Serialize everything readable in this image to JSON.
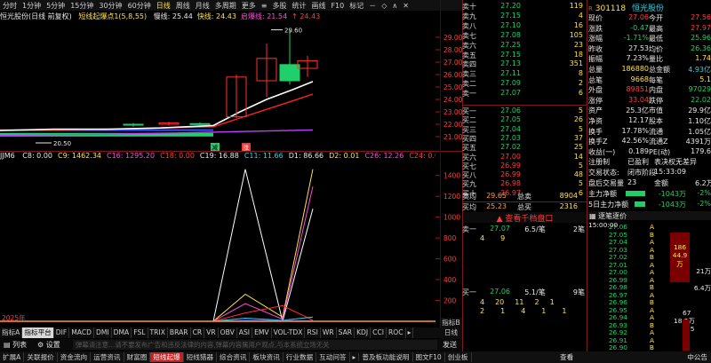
{
  "toolbar": {
    "items": [
      "分时",
      "1分钟",
      "5分钟",
      "15分钟",
      "30分钟",
      "60分钟",
      "日线",
      "周线",
      "月线",
      "多周期",
      "更多",
      "≡",
      "多股",
      "统计",
      "画线",
      "F10",
      "标记",
      "－",
      "◇",
      "∧",
      "✕"
    ],
    "selected": "日线"
  },
  "title_bar": {
    "stock": "恒光股份(日线 前复权)",
    "indicator": "短线起爆点1(5,8,55)",
    "seg": [
      {
        "t": "慢线: 25.44",
        "c": "w"
      },
      {
        "t": "快线: 24.43",
        "c": "y"
      },
      {
        "t": "启爆线: 21.54",
        "c": "m"
      },
      {
        "t": "↑ 24.43",
        "c": "r"
      }
    ]
  },
  "main_chart": {
    "y_ticks": [
      "29.00",
      "28.00",
      "27.00",
      "26.00",
      "25.00",
      "24.00",
      "23.00",
      "22.00",
      "21.00"
    ],
    "annotations": {
      "high": "29.60",
      "low": "20.50",
      "low_label": "20.50"
    },
    "markers": [
      "减",
      "涨"
    ],
    "candles": [
      {
        "o": 22.0,
        "h": 22.1,
        "l": 21.8,
        "c": 21.95
      },
      {
        "o": 22.0,
        "h": 22.2,
        "l": 21.9,
        "c": 22.1
      },
      {
        "o": 22.05,
        "h": 22.15,
        "l": 21.95,
        "c": 22.0
      },
      {
        "o": 22.6,
        "h": 26.0,
        "l": 22.5,
        "c": 25.8
      },
      {
        "o": 25.5,
        "h": 28.5,
        "l": 24.2,
        "c": 27.3
      },
      {
        "o": 26.8,
        "h": 29.6,
        "l": 25.2,
        "c": 25.5
      },
      {
        "o": 26.5,
        "h": 27.5,
        "l": 25.8,
        "c": 27.1
      }
    ]
  },
  "indicator_bar": {
    "name": "JJM6",
    "seg": [
      {
        "t": "C8: 0.00",
        "c": "w"
      },
      {
        "t": "C9: 1462.34",
        "c": "y"
      },
      {
        "t": "C16: 1295.20",
        "c": "m"
      },
      {
        "t": "C18: 0.00",
        "c": "r"
      },
      {
        "t": "C19: 16.88",
        "c": "w"
      },
      {
        "t": "C11: 11.66",
        "c": "c"
      },
      {
        "t": "D1: 86.66",
        "c": "w"
      },
      {
        "t": "D2: 0.01",
        "c": "y"
      },
      {
        "t": "C26: 12.26",
        "c": "m"
      },
      {
        "t": "C24: 0.00",
        "c": "r"
      }
    ]
  },
  "sub_chart": {
    "y_ticks": [
      "1400",
      "1200",
      "1000",
      "800",
      "600",
      "400",
      "200"
    ],
    "year_label": "2025年"
  },
  "tabs": [
    "指标A",
    "指标平台",
    "DIF",
    "MACD",
    "DMI",
    "DMA",
    "FSL",
    "TRIX",
    "BRAR",
    "CR",
    "VR",
    "OBV",
    "ASI",
    "EMV",
    "VOL-TDX",
    "RSI",
    "WR",
    "SAR",
    "KDJ",
    "CCI",
    "ROC",
    "▸"
  ],
  "tabs_right": [
    "指标B",
    "日线"
  ],
  "msg": {
    "list": "列表",
    "settings": "设置",
    "placeholder": "弹幕请注意…请不要发布广告和违反法律的内容,弹幕内容属用户观点,与本系统立场无关",
    "send": "发送"
  },
  "bottom_bar": [
    "扩展A",
    "关联报价",
    "资金流向",
    "运营资讯",
    "财富圈",
    "短线起爆",
    "短线猎器",
    "综合资讯",
    "板块资讯",
    "行业数据",
    "互动问答",
    "▸",
    "普及板功能说明",
    "图文F10",
    "创业板"
  ],
  "bottom_right": [
    "查看",
    "中公告"
  ],
  "order_book": {
    "asks": [
      {
        "lbl": "卖十",
        "p": "27.20",
        "v": "119"
      },
      {
        "lbl": "卖九",
        "p": "27.15",
        "v": "4"
      },
      {
        "lbl": "卖八",
        "p": "27.10",
        "v": "16"
      },
      {
        "lbl": "卖七",
        "p": "27.08",
        "v": "105"
      },
      {
        "lbl": "卖六",
        "p": "27.25",
        "v": "23"
      },
      {
        "lbl": "卖五",
        "p": "27.15",
        "v": "18"
      },
      {
        "lbl": "卖四",
        "p": "27.13",
        "v": "351"
      },
      {
        "lbl": "卖三",
        "p": "27.11",
        "v": "8"
      },
      {
        "lbl": "卖二",
        "p": "27.09",
        "v": "2"
      },
      {
        "lbl": "卖一",
        "p": "27.07",
        "v": "6"
      }
    ],
    "bids": [
      {
        "lbl": "买一",
        "p": "27.06",
        "v": "5"
      },
      {
        "lbl": "买二",
        "p": "27.05",
        "v": "26"
      },
      {
        "lbl": "买三",
        "p": "27.04",
        "v": "5"
      },
      {
        "lbl": "买四",
        "p": "27.03",
        "v": "37"
      },
      {
        "lbl": "买五",
        "p": "27.02",
        "v": "25"
      },
      {
        "lbl": "买六",
        "p": "27.00",
        "v": "14"
      },
      {
        "lbl": "买七",
        "p": "26.99",
        "v": "5"
      },
      {
        "lbl": "买八",
        "p": "26.99",
        "v": "48"
      },
      {
        "lbl": "买九",
        "p": "26.98",
        "v": "5"
      },
      {
        "lbl": "买十",
        "p": "26.97",
        "v": "6"
      }
    ],
    "avg_ask": {
      "lbl": "卖均",
      "p": "29.65",
      "t": "总卖",
      "v": "8904"
    },
    "avg_bid": {
      "lbl": "买均",
      "p": "25.23",
      "t": "总买",
      "v": "2316"
    }
  },
  "q1000": {
    "title": "查看千档盘口",
    "sell": {
      "lbl": "卖一",
      "p": "27.07",
      "q": "6.5/笔",
      "n": "2笔"
    },
    "sell_vals": [
      "4",
      "9"
    ],
    "buy": {
      "lbl": "买一",
      "p": "27.06",
      "q": "5.1/笔",
      "n": "9笔"
    },
    "buy_r1": [
      "4",
      "20",
      "11",
      "2",
      "1"
    ],
    "buy_r2": [
      "2",
      "1",
      "4",
      "1",
      "1"
    ]
  },
  "quote": {
    "code": "301118",
    "name": "恒光股份",
    "rows": [
      [
        {
          "t": "现价",
          "c": "w"
        },
        {
          "t": "27.06",
          "c": "r"
        },
        {
          "t": "今开",
          "c": "w"
        },
        {
          "t": "27.56",
          "c": "r"
        }
      ],
      [
        {
          "t": "涨跌",
          "c": "w"
        },
        {
          "t": "-0.47",
          "c": "g"
        },
        {
          "t": "最高",
          "c": "w"
        },
        {
          "t": "27.97",
          "c": "r"
        }
      ],
      [
        {
          "t": "涨幅",
          "c": "w"
        },
        {
          "t": "-1.71%",
          "c": "g"
        },
        {
          "t": "最低",
          "c": "w"
        },
        {
          "t": "25.96",
          "c": "g"
        }
      ],
      [
        {
          "t": "昨收",
          "c": "w"
        },
        {
          "t": "27.53",
          "c": "w"
        },
        {
          "t": "均价",
          "c": "w"
        },
        {
          "t": "26.36",
          "c": "g"
        }
      ],
      [
        {
          "t": "振幅",
          "c": "w"
        },
        {
          "t": "7.23%",
          "c": "w"
        },
        {
          "t": "量比",
          "c": "w"
        },
        {
          "t": "1.74",
          "c": "y"
        }
      ],
      [
        {
          "t": "总量",
          "c": "w"
        },
        {
          "t": "186880",
          "c": "y"
        },
        {
          "t": "总金额",
          "c": "w"
        },
        {
          "t": "4.93亿",
          "c": "c"
        }
      ],
      [
        {
          "t": "总笔",
          "c": "w"
        },
        {
          "t": "9668",
          "c": "y"
        },
        {
          "t": "每笔",
          "c": "w"
        },
        {
          "t": "5.1",
          "c": "y"
        }
      ],
      [
        {
          "t": "外盘",
          "c": "w"
        },
        {
          "t": "89851",
          "c": "r"
        },
        {
          "t": "内盘",
          "c": "w"
        },
        {
          "t": "97029",
          "c": "g"
        }
      ],
      [
        {
          "t": "涨停",
          "c": "w"
        },
        {
          "t": "33.04",
          "c": "r"
        },
        {
          "t": "跌停",
          "c": "w"
        },
        {
          "t": "22.02",
          "c": "g"
        }
      ],
      [
        {
          "t": "资产",
          "c": "w"
        },
        {
          "t": "25.3亿",
          "c": "w"
        },
        {
          "t": "市值",
          "c": "w"
        },
        {
          "t": "29.9亿",
          "c": "w"
        }
      ],
      [
        {
          "t": "净资",
          "c": "w"
        },
        {
          "t": "12.17",
          "c": "w"
        },
        {
          "t": "股本",
          "c": "w"
        },
        {
          "t": "1.10亿",
          "c": "w"
        }
      ],
      [
        {
          "t": "换手",
          "c": "w"
        },
        {
          "t": "17.78%",
          "c": "w"
        },
        {
          "t": "流通",
          "c": "w"
        },
        {
          "t": "1.05亿",
          "c": "w"
        }
      ],
      [
        {
          "t": "换手Z",
          "c": "w"
        },
        {
          "t": "42.56%",
          "c": "w"
        },
        {
          "t": "流通Z",
          "c": "w"
        },
        {
          "t": "4391万",
          "c": "w"
        }
      ],
      [
        {
          "t": "收益(一)",
          "c": "w"
        },
        {
          "t": "0.189",
          "c": "w"
        },
        {
          "t": "PE(动)",
          "c": "w"
        },
        {
          "t": "179.6",
          "c": "w"
        }
      ],
      [
        {
          "t": "注册制",
          "c": "w"
        },
        {
          "t": "已盈利",
          "c": "w"
        },
        {
          "t": "表决权无差异",
          "c": "w"
        },
        {
          "t": "",
          "c": "w"
        }
      ],
      [
        {
          "t": "交易状态:",
          "c": "w"
        },
        {
          "t": "闭市阶段",
          "c": "w"
        },
        {
          "t": "15:33:09",
          "c": "w"
        },
        {
          "t": "",
          "c": "w"
        }
      ],
      [
        {
          "t": "盘后交易量",
          "c": "w"
        },
        {
          "t": "23",
          "c": "w"
        },
        {
          "t": "金额",
          "c": "w"
        },
        {
          "t": "6.2万",
          "c": "w"
        }
      ]
    ],
    "flow1": {
      "lbl": "主力净额",
      "v": "-1043万",
      "p": "-2%"
    },
    "flow2": {
      "lbl": "5日主力净额",
      "v": "-1043万",
      "p": "-2%"
    }
  },
  "ticks": {
    "title": "逐笔逐价",
    "time": "15:00:00",
    "prices": [
      "27.06",
      "27.05",
      "27.04",
      "27.03",
      "27.02",
      "27.01",
      "27.00",
      "26.99",
      "26.98",
      "26.97",
      "26.96",
      "26.95",
      "26.94",
      "26.93",
      "26.92",
      "26.91",
      "26.90"
    ],
    "codes": [
      "A",
      "B",
      "A",
      "A",
      "B",
      "A",
      "A",
      "A",
      "B",
      "A",
      "B",
      "A",
      "A",
      "B",
      "A",
      "A",
      "B"
    ],
    "mid": {
      "v1": "186",
      "v2": "44.9万"
    },
    "right": {
      "v1": "21万",
      "v2": "6.4万",
      "v3": "67",
      "v4": "18.2万",
      "v5": "25"
    }
  }
}
